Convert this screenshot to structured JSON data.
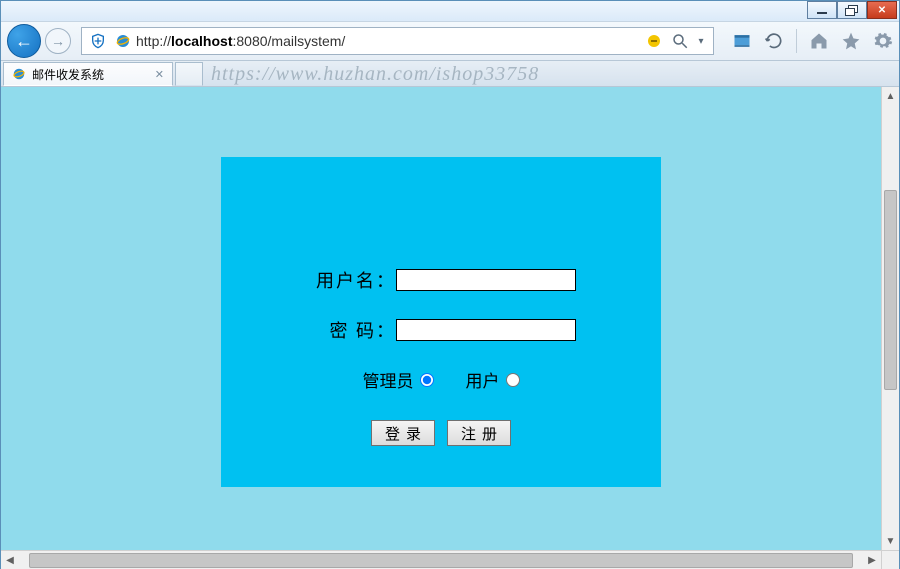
{
  "window": {
    "minimize": "minimize",
    "maximize": "restore",
    "close": "close"
  },
  "address": {
    "scheme": "http://",
    "host": "localhost",
    "port_path": ":8080/mailsystem/"
  },
  "tab": {
    "title": "邮件收发系统"
  },
  "watermark": "https://www.huzhan.com/ishop33758",
  "form": {
    "username_label": "用户名：",
    "password_label": "密 码：",
    "username_value": "",
    "password_value": "",
    "role_admin_label": "管理员",
    "role_user_label": "用户",
    "role_selected": "admin",
    "login_btn": "登录",
    "register_btn": "注册"
  }
}
